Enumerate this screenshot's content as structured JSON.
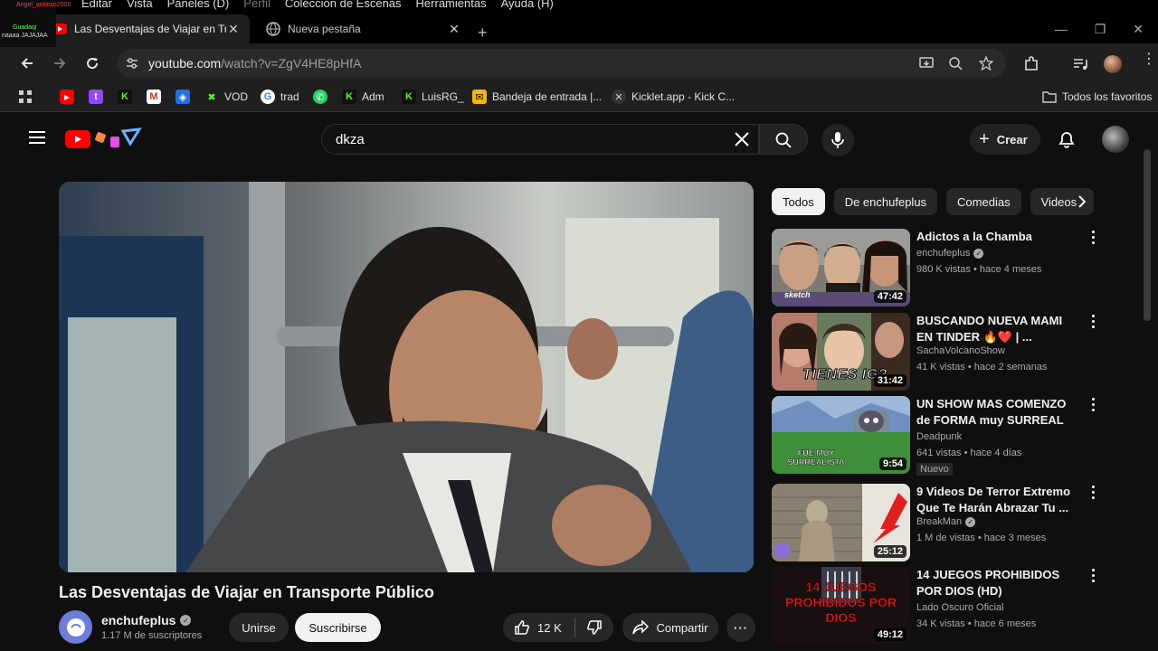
{
  "os_menu": {
    "items": [
      "Editar",
      "Vista",
      "Paneles (D)",
      "Perfil",
      "Colección de Escenas",
      "Herramientas",
      "Ayuda (H)"
    ],
    "overlay_user": "Angel_antonio2000",
    "overlay_user2": "Guadaqi",
    "overlay_msg": "naaaa JAJAJAA"
  },
  "browser": {
    "tabs": [
      {
        "title": "Las Desventajas de Viajar en Tra",
        "active": true
      },
      {
        "title": "Nueva pestaña",
        "active": false
      }
    ],
    "url_host": "youtube.com",
    "url_path": "/watch?v=ZgV4HE8pHfA",
    "bookmarks": [
      "VOD",
      "trad",
      "Adm",
      "LuisRG_",
      "Bandeja de entrada |...",
      "Kicklet.app - Kick C..."
    ],
    "all_bookmarks": "Todos los favoritos"
  },
  "youtube": {
    "search_query": "dkza",
    "create_label": "Crear",
    "video": {
      "title": "Las Desventajas de Viajar en Transporte Público",
      "channel": "enchufeplus",
      "subscribers": "1.17 M de suscriptores",
      "join_label": "Unirse",
      "subscribe_label": "Suscribirse",
      "likes": "12 K",
      "share_label": "Compartir"
    },
    "chips": [
      "Todos",
      "De enchufeplus",
      "Comedias",
      "Videos"
    ],
    "recommendations": [
      {
        "title": "Adictos a la Chamba",
        "channel": "enchufeplus",
        "verified": true,
        "meta": "980 K vistas • hace 4 meses",
        "duration": "47:42",
        "badge": ""
      },
      {
        "title": "BUSCANDO NUEVA MAMI EN TINDER 🔥❤️ | ...",
        "channel": "SachaVolcanoShow",
        "verified": false,
        "meta": "41 K vistas • hace 2 semanas",
        "duration": "31:42",
        "badge": ""
      },
      {
        "title": "UN SHOW MAS COMENZO de FORMA muy SURREAL ‼️ ...",
        "channel": "Deadpunk",
        "verified": false,
        "meta": "641 vistas • hace 4 días",
        "duration": "9:54",
        "badge": "Nuevo"
      },
      {
        "title": "9 Videos De Terror Extremo Que Te Harán Abrazar Tu ...",
        "channel": "BreakMan",
        "verified": true,
        "meta": "1 M de vistas • hace 3 meses",
        "duration": "25:12",
        "badge": ""
      },
      {
        "title": "14 JUEGOS PROHIBIDOS POR DIOS (HD)",
        "channel": "Lado Oscuro Oficial",
        "verified": false,
        "meta": "34 K vistas • hace 6 meses",
        "duration": "49:12",
        "badge": ""
      }
    ],
    "thumb_texts": {
      "t1": "sketch",
      "t2": "TIENES IG?",
      "t3": "FUE MUY SURREALISTA",
      "t5": "14 JUEGOS PROHIBIDOS POR DIOS"
    }
  }
}
